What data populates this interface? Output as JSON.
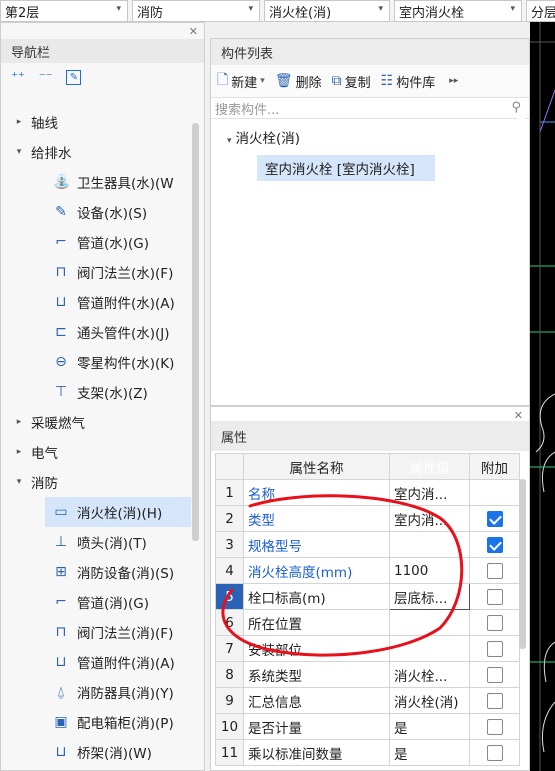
{
  "topbar": {
    "floor": "第2层",
    "discipline": "消防",
    "category": "消火栓(消)",
    "component": "室内消火栓",
    "extra": "分层"
  },
  "nav": {
    "title": "导航栏",
    "tree": [
      {
        "label": "轴线",
        "level": 0,
        "caret": "▸"
      },
      {
        "label": "给排水",
        "level": 0,
        "caret": "▾"
      },
      {
        "label": "卫生器具(水)(W",
        "level": 1,
        "icon": "sanitary-icon"
      },
      {
        "label": "设备(水)(S)",
        "level": 1,
        "icon": "equipment-icon"
      },
      {
        "label": "管道(水)(G)",
        "level": 1,
        "icon": "pipe-icon"
      },
      {
        "label": "阀门法兰(水)(F)",
        "level": 1,
        "icon": "valve-icon"
      },
      {
        "label": "管道附件(水)(A)",
        "level": 1,
        "icon": "pipe-accessory-icon"
      },
      {
        "label": "通头管件(水)(J)",
        "level": 1,
        "icon": "fitting-icon"
      },
      {
        "label": "零星构件(水)(K)",
        "level": 1,
        "icon": "misc-part-icon"
      },
      {
        "label": "支架(水)(Z)",
        "level": 1,
        "icon": "bracket-icon"
      },
      {
        "label": "采暖燃气",
        "level": 0,
        "caret": "▸"
      },
      {
        "label": "电气",
        "level": 0,
        "caret": "▸"
      },
      {
        "label": "消防",
        "level": 0,
        "caret": "▾"
      },
      {
        "label": "消火栓(消)(H)",
        "level": 1,
        "icon": "hydrant-icon",
        "selected": true
      },
      {
        "label": "喷头(消)(T)",
        "level": 1,
        "icon": "sprinkler-icon"
      },
      {
        "label": "消防设备(消)(S)",
        "level": 1,
        "icon": "fire-equipment-icon"
      },
      {
        "label": "管道(消)(G)",
        "level": 1,
        "icon": "pipe-icon"
      },
      {
        "label": "阀门法兰(消)(F)",
        "level": 1,
        "icon": "valve-icon"
      },
      {
        "label": "管道附件(消)(A)",
        "level": 1,
        "icon": "pipe-accessory-icon"
      },
      {
        "label": "消防器具(消)(Y)",
        "level": 1,
        "icon": "fire-device-icon"
      },
      {
        "label": "配电箱柜(消)(P)",
        "level": 1,
        "icon": "panel-box-icon"
      },
      {
        "label": "桥架(消)(W)",
        "level": 1,
        "icon": "tray-icon"
      }
    ]
  },
  "comp": {
    "title": "构件列表",
    "new_label": "新建",
    "delete_label": "删除",
    "copy_label": "复制",
    "library_label": "构件库",
    "search_placeholder": "搜索构件...",
    "group": "消火栓(消)",
    "item": "室内消火栓 [室内消火栓]"
  },
  "props": {
    "title": "属性",
    "col_name": "属性名称",
    "col_value": "属性值",
    "col_add": "附加",
    "rows": [
      {
        "n": "1",
        "name": "名称",
        "value": "室内消...",
        "blue": true,
        "cb": null
      },
      {
        "n": "2",
        "name": "类型",
        "value": "室内消...",
        "blue": true,
        "cb": true
      },
      {
        "n": "3",
        "name": "规格型号",
        "value": "",
        "blue": true,
        "cb": true
      },
      {
        "n": "4",
        "name": "消火栓高度(mm)",
        "value": "1100",
        "blue": true,
        "cb": false
      },
      {
        "n": "5",
        "name": "栓口标高(m)",
        "value": "层底标...",
        "blue": false,
        "cb": false
      },
      {
        "n": "6",
        "name": "所在位置",
        "value": "",
        "blue": false,
        "cb": false
      },
      {
        "n": "7",
        "name": "安装部位",
        "value": "",
        "blue": false,
        "cb": false
      },
      {
        "n": "8",
        "name": "系统类型",
        "value": "消火栓...",
        "blue": false,
        "cb": false
      },
      {
        "n": "9",
        "name": "汇总信息",
        "value": "消火栓(消)",
        "blue": false,
        "cb": false
      },
      {
        "n": "10",
        "name": "是否计量",
        "value": "是",
        "blue": false,
        "cb": false
      },
      {
        "n": "11",
        "name": "乘以标准间数量",
        "value": "是",
        "blue": false,
        "cb": false
      }
    ]
  },
  "colors": {
    "accent": "#1a73e8",
    "header_blue": "#5b9bd5",
    "annotation_red": "#e8101a"
  }
}
